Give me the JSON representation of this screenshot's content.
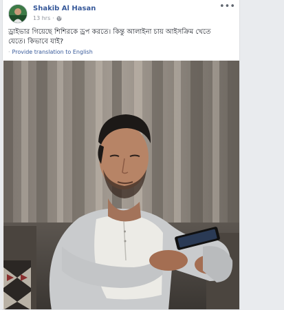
{
  "post": {
    "author": "Shakib Al Hasan",
    "time": "13 hrs",
    "separator": "·",
    "text": "ড্রাইভার গিয়েছে শিশিরকে ড্রপ করতে। কিন্তু আলাইনা চায় আইসক্রিম খেতে যেতে। কিভাবে যাই?",
    "translate_dot": "·",
    "translate_label": "Provide translation to English",
    "more_label": "•••",
    "privacy_icon": "globe-icon",
    "photo_alt": "Man in grey raglan shirt looking at phone on a sofa"
  },
  "colors": {
    "link": "#365899",
    "meta": "#90949c",
    "text": "#1d2129",
    "page_bg": "#e9ebee"
  }
}
